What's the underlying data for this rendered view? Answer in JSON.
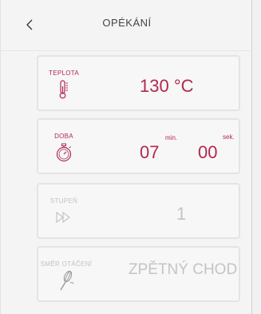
{
  "header": {
    "title": "OPÉKÁNÍ",
    "back_icon": "chevron-left-icon"
  },
  "temperature": {
    "label": "TEPLOTA",
    "value": "130 °C",
    "icon": "thermometer-icon"
  },
  "duration": {
    "label": "DOBA",
    "minutes": "07",
    "min_unit": "min.",
    "seconds": "00",
    "sec_unit": "sek.",
    "icon": "stopwatch-icon"
  },
  "speed": {
    "label": "STUPEŇ",
    "value": "1",
    "icon": "fast-forward-icon"
  },
  "rotation": {
    "label": "SMĚR OTÁČENÍ",
    "value": "ZPĚTNÝ CHOD",
    "icon": "whisk-icon"
  },
  "colors": {
    "accent": "#b0284f",
    "disabled": "#c4c4c4",
    "background": "#f4f4f4"
  }
}
